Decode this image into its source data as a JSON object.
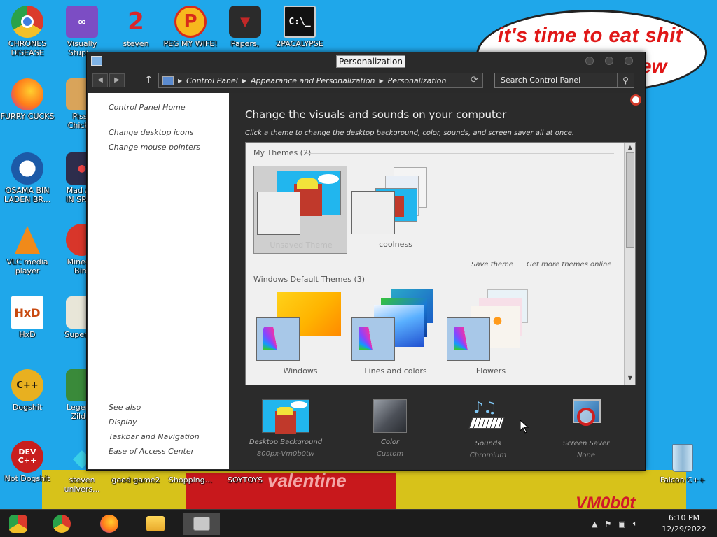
{
  "desktop": {
    "speech_bubble": {
      "line1": "it's time to eat shit",
      "line2": "ew"
    },
    "wall_text": {
      "sign": "valentine",
      "signature": "VM0b0t"
    },
    "icons": [
      {
        "label": "CHRONES\nDISEASE",
        "icon": "chrome-icon"
      },
      {
        "label": "Visually\nStupi...",
        "icon": "visual-studio-icon"
      },
      {
        "label": "steven",
        "icon": "number-two-icon"
      },
      {
        "label": "PEG MY WIFE!",
        "icon": "p-logo-icon"
      },
      {
        "label": "Papers,",
        "icon": "papers-please-icon"
      },
      {
        "label": "2PACALYPSE",
        "icon": "terminal-icon",
        "glyph": "C:\\_"
      },
      {
        "label": "FURRY CUCKS",
        "icon": "firefox-icon"
      },
      {
        "label": "Pissc\nChick...",
        "icon": "chicken-game-icon"
      },
      {
        "label": "OSAMA BIN\nLADEN BR...",
        "icon": "campaign-logo-icon"
      },
      {
        "label": "Mad A...\nIN SPA...",
        "icon": "angry-birds-space-icon"
      },
      {
        "label": "VLC media\nplayer",
        "icon": "vlc-icon"
      },
      {
        "label": "Minec...\nBird",
        "icon": "angry-bird-icon"
      },
      {
        "label": "HxD",
        "icon": "hxd-icon",
        "glyph": "HxD"
      },
      {
        "label": "Super I...",
        "icon": "pixel-art-icon"
      },
      {
        "label": "Dogshit",
        "icon": "cpp-icon"
      },
      {
        "label": "Legen...\nZild...",
        "icon": "zelda-icon"
      },
      {
        "label": "Not Dogshit",
        "icon": "dev-cpp-icon",
        "glyph": "DEV\nC++"
      },
      {
        "label": "steven\nunivers...",
        "icon": "gem-icon"
      },
      {
        "label": "good game2",
        "icon": "shortcut-icon"
      },
      {
        "label": "Shopping...",
        "icon": "shortcut-icon"
      },
      {
        "label": "SOYTOYS",
        "icon": "shortcut-icon"
      },
      {
        "label": "Falcon C++",
        "icon": "recycle-bin-icon"
      }
    ]
  },
  "window": {
    "title": "Personalization",
    "breadcrumb": [
      "Control Panel",
      "Appearance and Personalization",
      "Personalization"
    ],
    "search_placeholder": "Search Control Panel",
    "left_links": {
      "home": "Control Panel Home",
      "desktop_icons": "Change desktop icons",
      "mouse_pointers": "Change mouse pointers"
    },
    "see_also": {
      "heading": "See also",
      "items": [
        "Display",
        "Taskbar and Navigation",
        "Ease of Access Center"
      ]
    },
    "main": {
      "title": "Change the visuals and sounds on your computer",
      "subtitle": "Click a theme to change the desktop background, color, sounds, and screen saver all at once.",
      "my_themes": {
        "heading": "My Themes (2)",
        "items": [
          {
            "name": "Unsaved Theme",
            "selected": true
          },
          {
            "name": "coolness",
            "selected": false
          }
        ],
        "save_link": "Save theme",
        "more_link": "Get more themes online"
      },
      "default_themes": {
        "heading": "Windows Default Themes (3)",
        "items": [
          {
            "name": "Windows"
          },
          {
            "name": "Lines and colors"
          },
          {
            "name": "Flowers"
          }
        ]
      },
      "settings": [
        {
          "label": "Desktop Background",
          "value": "800px-Vm0b0tw"
        },
        {
          "label": "Color",
          "value": "Custom"
        },
        {
          "label": "Sounds",
          "value": "Chromium"
        },
        {
          "label": "Screen Saver",
          "value": "None"
        }
      ]
    }
  },
  "taskbar": {
    "time": "6:10 PM",
    "date": "12/29/2022",
    "pinned": [
      "start-icon",
      "chrome-icon",
      "firefox-icon",
      "file-explorer-icon",
      "control-panel-icon"
    ]
  }
}
